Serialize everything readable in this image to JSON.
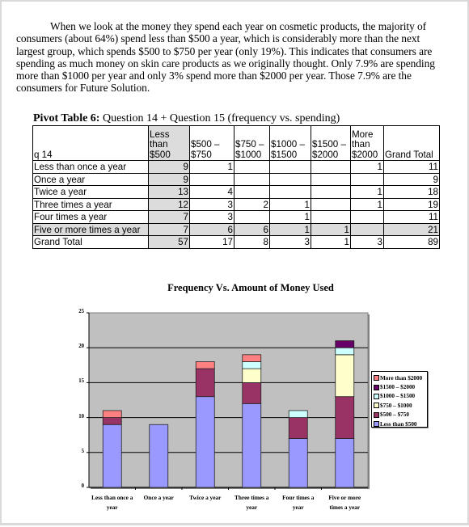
{
  "document": {
    "paragraph": "When we look at the money they spend each year on cosmetic products, the majority of consumers (about 64%) spend less than $500 a year, which is considerably more than the next largest group, which spends $500 to $750 per year (only 19%). This indicates that consumers are spending as much money on skin care products as we originally thought. Only 7.9% are spending more than $1000 per year and only 3% spend more than $2000 per year. Those 7.9% are the consumers for Future Solution.",
    "table_title_bold": "Pivot Table 6:",
    "table_title_rest": " Question 14 + Question 15 (frequency vs. spending)"
  },
  "pivot_table": {
    "row_header": "q 14",
    "columns": [
      [
        "Less",
        "than",
        "$500"
      ],
      [
        "",
        "$500 –",
        "$750"
      ],
      [
        "",
        "$750 –",
        "$1000"
      ],
      [
        "",
        "$1000 –",
        "$1500"
      ],
      [
        "",
        "$1500 –",
        "$2000"
      ],
      [
        "More",
        "than",
        "$2000"
      ],
      [
        "",
        "",
        "Grand Total"
      ]
    ],
    "rows": [
      {
        "label": "Less than once a year",
        "values": [
          "9",
          "1",
          "",
          "",
          "",
          "1",
          "11"
        ]
      },
      {
        "label": "Once a year",
        "values": [
          "9",
          "",
          "",
          "",
          "",
          "",
          "9"
        ]
      },
      {
        "label": "Twice a year",
        "values": [
          "13",
          "4",
          "",
          "",
          "",
          "1",
          "18"
        ]
      },
      {
        "label": "Three times a year",
        "values": [
          "12",
          "3",
          "2",
          "1",
          "",
          "1",
          "19"
        ]
      },
      {
        "label": "Four times a year",
        "values": [
          "7",
          "3",
          "",
          "1",
          "",
          "",
          "11"
        ]
      },
      {
        "label": "Five or more times a year",
        "values": [
          "7",
          "6",
          "6",
          "1",
          "1",
          "",
          "21"
        ]
      },
      {
        "label": "Grand Total",
        "values": [
          "57",
          "17",
          "8",
          "3",
          "1",
          "3",
          "89"
        ]
      }
    ]
  },
  "chart_data": {
    "type": "bar",
    "stacked": true,
    "title": "Frequency Vs. Amount of Money Used",
    "xlabel": "",
    "ylabel": "",
    "ylim": [
      0,
      25
    ],
    "yticks": [
      "0",
      "5",
      "10",
      "15",
      "20",
      "25"
    ],
    "grid": true,
    "legend_position": "right",
    "categories": [
      "Less than once a year",
      "Once a year",
      "Twice a year",
      "Three times a year",
      "Four times a year",
      "Five or more times a year"
    ],
    "category_lines": [
      [
        "Less than once a",
        "year"
      ],
      [
        "Once a year"
      ],
      [
        "Twice a year"
      ],
      [
        "Three times a",
        "year"
      ],
      [
        "Four times a",
        "year"
      ],
      [
        "Five or more",
        "times a year"
      ]
    ],
    "series": [
      {
        "name": "Less than $500",
        "color": "#9999ff",
        "values": [
          9,
          9,
          13,
          12,
          7,
          7
        ]
      },
      {
        "name": "$500 – $750",
        "color": "#993366",
        "values": [
          1,
          0,
          4,
          3,
          3,
          6
        ]
      },
      {
        "name": "$750 – $1000",
        "color": "#ffffcc",
        "values": [
          0,
          0,
          0,
          2,
          0,
          6
        ]
      },
      {
        "name": "$1000 – $1500",
        "color": "#ccffff",
        "values": [
          0,
          0,
          0,
          1,
          1,
          1
        ]
      },
      {
        "name": "$1500 – $2000",
        "color": "#660066",
        "values": [
          0,
          0,
          0,
          0,
          0,
          1
        ]
      },
      {
        "name": "More than $2000",
        "color": "#ff8080",
        "values": [
          1,
          0,
          1,
          1,
          0,
          0
        ]
      }
    ],
    "plot_background": "#c0c0c0"
  }
}
